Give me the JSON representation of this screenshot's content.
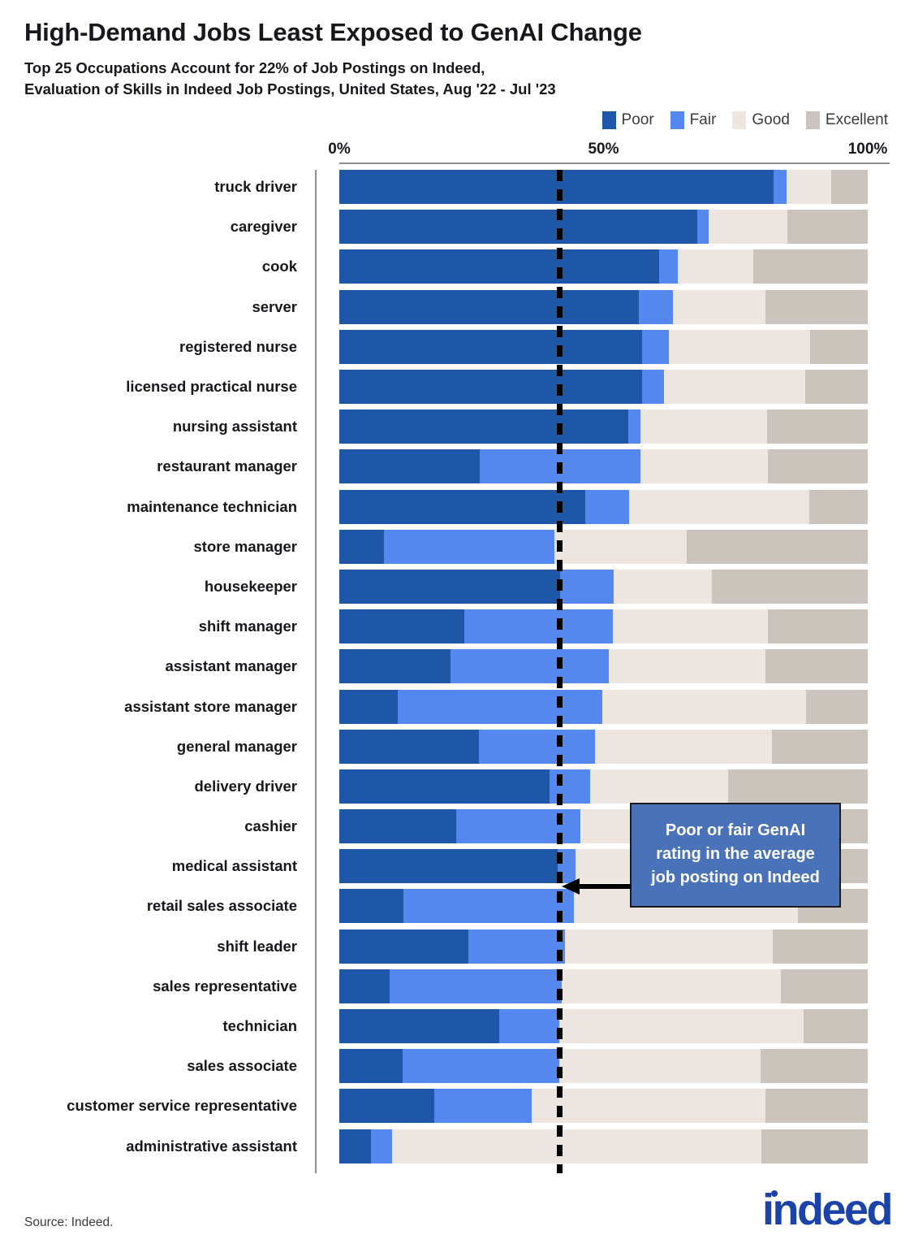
{
  "header": {
    "title": "High-Demand Jobs Least Exposed to GenAI Change",
    "subtitle": "Top 25 Occupations Account for 22% of Job Postings on Indeed,\nEvaluation of Skills in Indeed Job Postings, United States, Aug '22 - Jul '23"
  },
  "footer": {
    "source": "Source: Indeed.",
    "logo": "indeed"
  },
  "annotation": {
    "text": "Poor or fair GenAI rating in the average job posting on Indeed",
    "fill": "#4a72b8",
    "border": "#1b1b1b"
  },
  "chart_data": {
    "type": "bar",
    "orientation": "horizontal",
    "stacked": true,
    "normalized": true,
    "title": "High-Demand Jobs Least Exposed to GenAI Change",
    "subtitle": "Top 25 Occupations Account for 22% of Job Postings on Indeed, Evaluation of Skills in Indeed Job Postings, United States, Aug '22 - Jul '23",
    "xlabel": "",
    "ylabel": "",
    "xlim": [
      0,
      100
    ],
    "xticks": [
      0,
      50,
      100
    ],
    "xtick_labels": [
      "0%",
      "50%",
      "100%"
    ],
    "grid": false,
    "legend_position": "top-right",
    "reference_line": {
      "value": 50,
      "style": "dashed",
      "color": "#000000",
      "label": "Poor or fair GenAI rating in the average job posting on Indeed"
    },
    "legend": [
      {
        "name": "Poor",
        "color": "#1f57a8"
      },
      {
        "name": "Fair",
        "color": "#5588ee"
      },
      {
        "name": "Good",
        "color": "#ece5e0"
      },
      {
        "name": "Excellent",
        "color": "#cbc4bd"
      }
    ],
    "categories": [
      "truck driver",
      "caregiver",
      "cook",
      "server",
      "registered nurse",
      "licensed practical nurse",
      "nursing assistant",
      "restaurant manager",
      "maintenance technician",
      "store manager",
      "housekeeper",
      "shift manager",
      "assistant manager",
      "assistant store manager",
      "general manager",
      "delivery driver",
      "cashier",
      "medical assistant",
      "retail sales associate",
      "shift leader",
      "sales representative",
      "technician",
      "sales associate",
      "customer service representative",
      "administrative assistant"
    ],
    "series": [
      {
        "name": "Poor",
        "color": "#1f57a8",
        "values": [
          82.2,
          67.7,
          60.5,
          56.7,
          57.3,
          57.3,
          54.7,
          26.6,
          46.5,
          8.4,
          41.8,
          23.7,
          21.0,
          11.1,
          26.4,
          39.8,
          22.1,
          41.3,
          12.1,
          24.4,
          9.5,
          30.3,
          12.0,
          18.0,
          6.0
        ]
      },
      {
        "name": "Fair",
        "color": "#5588ee",
        "values": [
          2.5,
          2.2,
          3.5,
          6.5,
          5.1,
          4.1,
          2.3,
          30.4,
          8.3,
          32.3,
          10.1,
          28.1,
          30.0,
          38.6,
          22.0,
          7.7,
          23.6,
          3.4,
          32.3,
          18.3,
          32.6,
          11.4,
          29.6,
          18.4,
          4.0
        ]
      },
      {
        "name": "Good",
        "color": "#ece5e0",
        "values": [
          8.4,
          14.9,
          14.4,
          17.5,
          26.7,
          26.7,
          24.0,
          24.1,
          34.1,
          25.0,
          18.6,
          29.3,
          29.6,
          38.7,
          33.5,
          26.1,
          40.4,
          35.8,
          42.4,
          39.4,
          41.5,
          46.1,
          38.2,
          44.2,
          69.9
        ]
      },
      {
        "name": "Excellent",
        "color": "#cbc4bd",
        "values": [
          6.9,
          15.2,
          21.6,
          19.3,
          10.9,
          11.9,
          19.0,
          18.9,
          11.1,
          34.3,
          29.5,
          18.9,
          19.4,
          11.6,
          18.1,
          26.4,
          13.9,
          19.5,
          13.2,
          17.9,
          16.4,
          12.2,
          20.2,
          19.4,
          20.1
        ]
      }
    ]
  }
}
